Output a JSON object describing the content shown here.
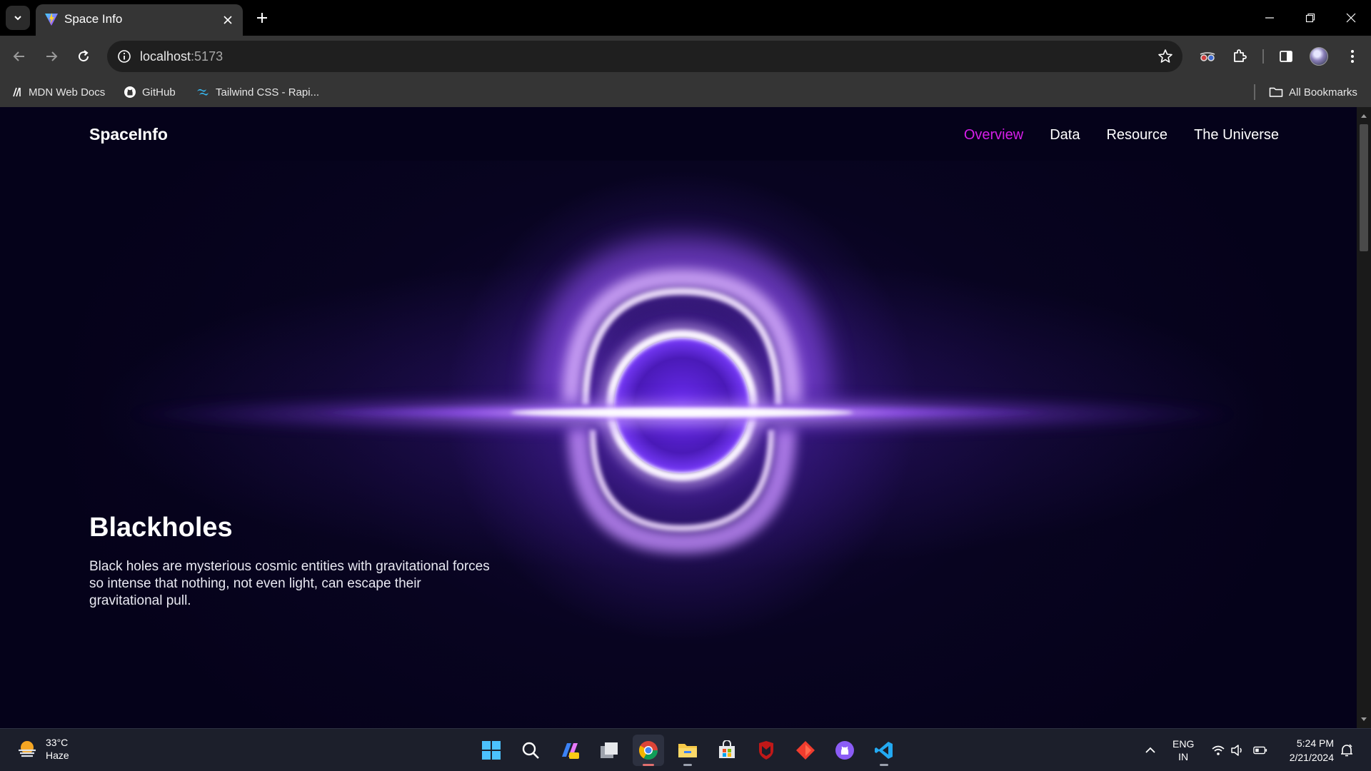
{
  "browser": {
    "tab": {
      "title": "Space Info"
    },
    "address": {
      "host": "localhost",
      "port": ":5173"
    },
    "bookmarks": [
      {
        "label": "MDN Web Docs",
        "icon": "mdn-icon"
      },
      {
        "label": "GitHub",
        "icon": "github-icon"
      },
      {
        "label": "Tailwind CSS - Rapi...",
        "icon": "tailwind-icon"
      }
    ],
    "all_bookmarks": "All Bookmarks"
  },
  "site": {
    "logo": "SpaceInfo",
    "nav": [
      {
        "label": "Overview",
        "active": true
      },
      {
        "label": "Data",
        "active": false
      },
      {
        "label": "Resource",
        "active": false
      },
      {
        "label": "The Universe",
        "active": false
      }
    ],
    "hero": {
      "title": "Blackholes",
      "description": "Black holes are mysterious cosmic entities with gravitational forces so intense that nothing, not even light, can escape their gravitational pull."
    }
  },
  "taskbar": {
    "weather": {
      "temp": "33°C",
      "condition": "Haze"
    },
    "language": {
      "line1": "ENG",
      "line2": "IN"
    },
    "clock": {
      "time": "5:24 PM",
      "date": "2/21/2024"
    }
  },
  "colors": {
    "accent": "#d51ee8",
    "page_bg": "#05021a",
    "glow": "#8a3dff"
  }
}
